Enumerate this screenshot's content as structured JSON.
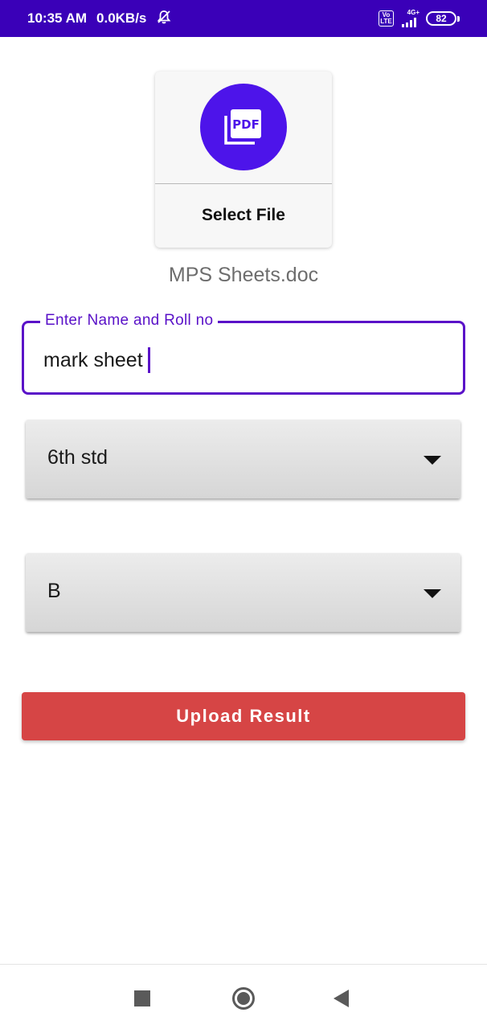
{
  "status_bar": {
    "time": "10:35 AM",
    "network_speed": "0.0KB/s",
    "volte_label": "Vo LTE",
    "network_type": "4G+",
    "battery": "82",
    "icons": [
      "bell-off-icon",
      "signal-icon",
      "battery-icon"
    ]
  },
  "file_picker": {
    "icon": "pdf-icon",
    "icon_text": "PDF",
    "select_label": "Select File",
    "selected_file_name": "MPS Sheets.doc"
  },
  "name_field": {
    "label": "Enter Name and Roll no",
    "value": "mark sheet"
  },
  "standard_spinner": {
    "selected": "6th std"
  },
  "division_spinner": {
    "selected": "B"
  },
  "upload_button": {
    "label": "Upload Result"
  },
  "colors": {
    "status_bar": "#3a00b8",
    "accent": "#5a12c8",
    "pdf_circle": "#4d14ea",
    "upload_button": "#d64545"
  },
  "nav_bar": {
    "icons": [
      "recents-square-icon",
      "home-circle-icon",
      "back-triangle-icon"
    ]
  }
}
